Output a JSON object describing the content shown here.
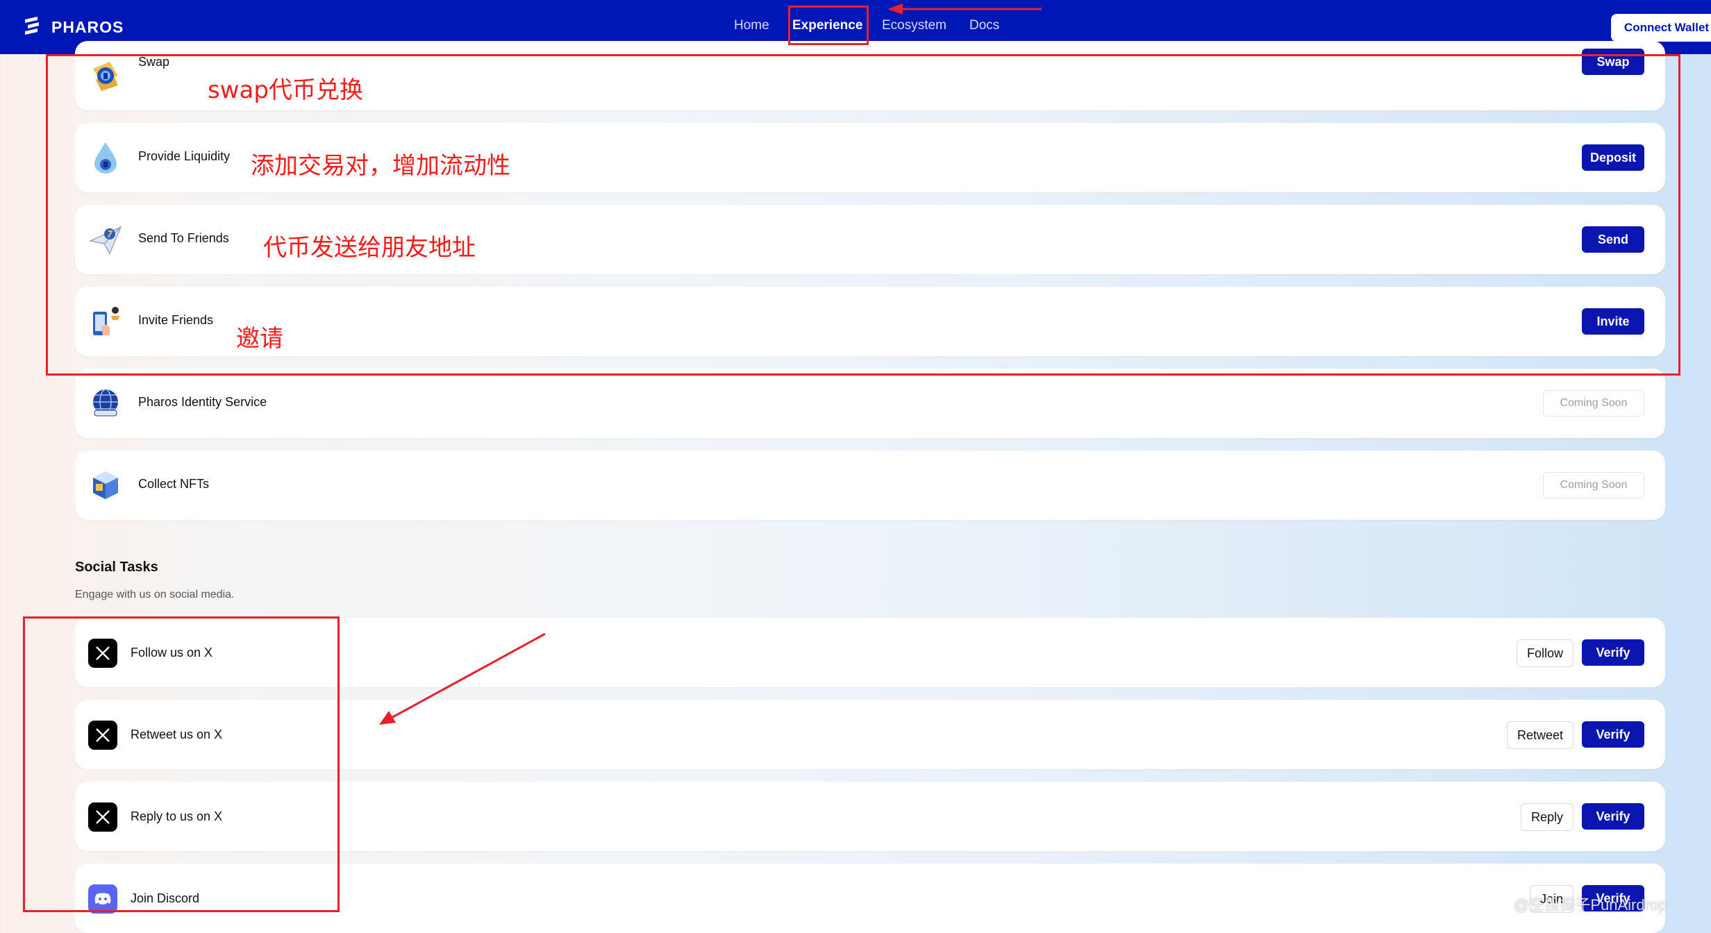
{
  "header": {
    "brand": "PHAROS",
    "nav": [
      "Home",
      "Experience",
      "Ecosystem",
      "Docs"
    ],
    "active_nav": "Experience",
    "connect_label": "Connect Wallet"
  },
  "tasks": [
    {
      "label": "Swap",
      "button": "Swap",
      "icon": "swap-coin-icon"
    },
    {
      "label": "Provide Liquidity",
      "button": "Deposit",
      "icon": "liquidity-drop-icon"
    },
    {
      "label": "Send To Friends",
      "button": "Send",
      "icon": "send-plane-icon"
    },
    {
      "label": "Invite Friends",
      "button": "Invite",
      "icon": "invite-phone-icon"
    },
    {
      "label": "Pharos Identity Service",
      "button": "Coming Soon",
      "icon": "globe-identity-icon"
    },
    {
      "label": "Collect NFTs",
      "button": "Coming Soon",
      "icon": "nft-cube-icon"
    }
  ],
  "social": {
    "title": "Social Tasks",
    "subtitle": "Engage with us on social media.",
    "items": [
      {
        "label": "Follow us on X",
        "action": "Follow",
        "verify": "Verify"
      },
      {
        "label": "Retweet us on X",
        "action": "Retweet",
        "verify": "Verify"
      },
      {
        "label": "Reply to us on X",
        "action": "Reply",
        "verify": "Verify"
      },
      {
        "label": "Join Discord",
        "action": "Join",
        "verify": "Verify"
      }
    ]
  },
  "annotations": {
    "swap": "swap代币兑换",
    "liquidity": "添加交易对，增加流动性",
    "send": "代币发送给朋友地址",
    "invite": "邀请"
  },
  "watermark": "@空投探子PunAirdrop",
  "colors": {
    "header": "#0017b8",
    "button": "#0b16b0",
    "annotation": "#ff1a1a"
  }
}
